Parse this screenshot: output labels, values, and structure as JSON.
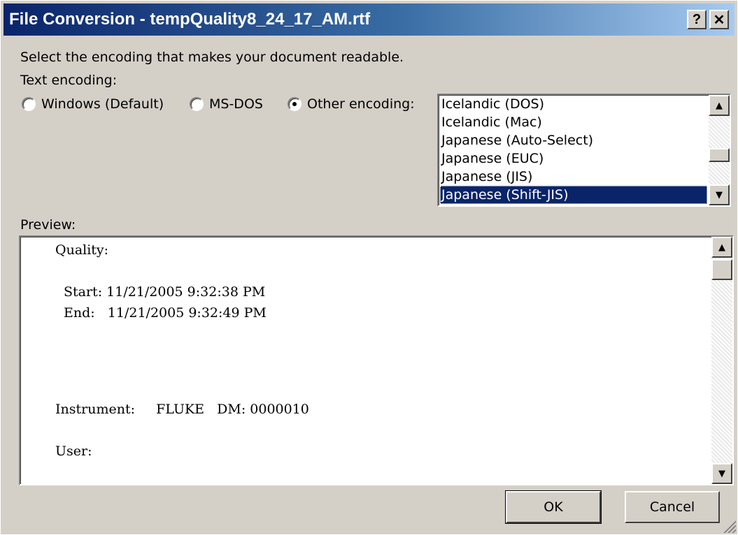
{
  "window": {
    "title": "File Conversion - tempQuality8_24_17_AM.rtf",
    "help_label": "?",
    "close_label": "x"
  },
  "instruction": "Select the encoding that makes your document readable.",
  "text_encoding_label": "Text encoding:",
  "radios": [
    {
      "label": "Windows (Default)",
      "mnemonic": "W",
      "checked": false
    },
    {
      "label": "MS-DOS",
      "mnemonic": "D",
      "checked": false
    },
    {
      "label": "Other encoding:",
      "mnemonic": "O",
      "checked": true
    }
  ],
  "encodings": {
    "items": [
      "Icelandic (DOS)",
      "Icelandic (Mac)",
      "Japanese (Auto-Select)",
      "Japanese (EUC)",
      "Japanese (JIS)",
      "Japanese (Shift-JIS)"
    ],
    "selected": "Japanese (Shift-JIS)"
  },
  "preview": {
    "label": "Preview:",
    "lines": [
      "Quality:",
      "Start: 11/21/2005 9:32:38 PM",
      "End:   11/21/2005 9:32:49 PM",
      "Instrument:     FLUKE   DM: 0000010",
      "User:"
    ]
  },
  "buttons": {
    "ok": "OK",
    "cancel": "Cancel"
  }
}
